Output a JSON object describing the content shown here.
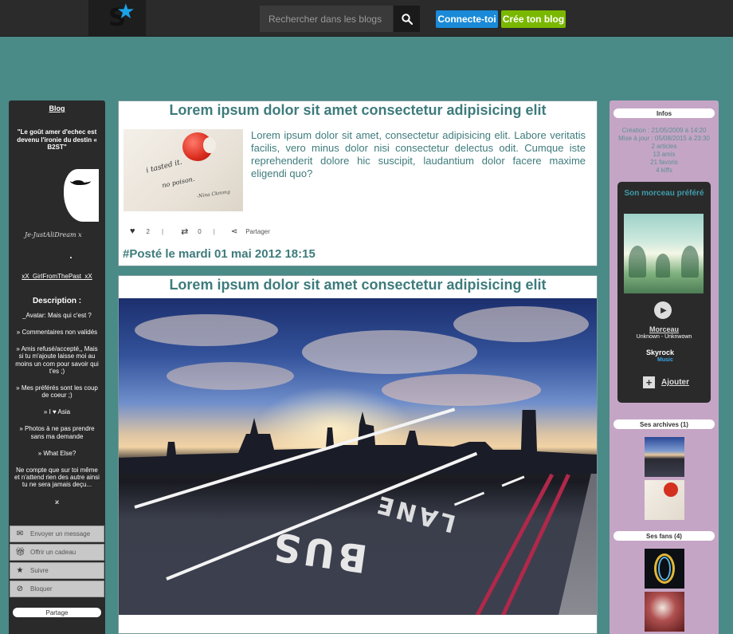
{
  "topbar": {
    "search_placeholder": "Rechercher dans les blogs",
    "connect_label": "Connecte-toi",
    "create_label": "Crée ton blog",
    "colors": {
      "connect": "#1a8ad8",
      "create": "#7ab800"
    }
  },
  "left": {
    "blog_link": "Blog",
    "quote": "\"Le goût amer d'echec est devenu l'ironie du destin « B2ST\"",
    "signature": "Je-JustAliDream x",
    "username": "xX_GirlFromThePast_xX",
    "description_title": "Description :",
    "description_lines": [
      "_Avatar: Mais qui c'est ?",
      "» Commentaires non validés",
      "» Amis refusé/accepté,, Mais si tu m'ajoute laisse moi au moins un com pour savoir qui t'es ;)",
      "» Mes préférés sont les coup de coeur ;)",
      "» I ♥ Asia",
      "» Photos à ne pas prendre sans ma demande",
      "» What Else?",
      "Ne compte que sur toi même et n'attend rien des autre ainsi tu ne sera jamais deçu...",
      "ϰ"
    ],
    "menu": [
      {
        "label": "Envoyer un message",
        "icon": "envelope-icon"
      },
      {
        "label": "Offrir un cadeau",
        "icon": "gift-icon"
      },
      {
        "label": "Suivre",
        "icon": "star-icon"
      },
      {
        "label": "Bloquer",
        "icon": "block-icon"
      }
    ],
    "partage_label": "Partage"
  },
  "posts": [
    {
      "title": "Lorem ipsum dolor sit amet consectetur adipisicing elit",
      "thumbnail_text": [
        "i tasted it.",
        "no poison.",
        "-Nina Ckmmg"
      ],
      "body": "Lorem ipsum dolor sit amet, consectetur adipisicing elit. Labore veritatis facilis, vero minus dolor nisi consectetur delectus odit. Cumque iste reprehenderit dolore hic suscipit, laudantium dolor facere maxime eligendi quo?",
      "likes": "2",
      "reposts": "0",
      "separator": "|",
      "share_label": "Partager",
      "posted": "#Posté le mardi 01 mai 2012 18:15"
    },
    {
      "title": "Lorem ipsum dolor sit amet consectetur adipisicing elit",
      "image_text": [
        "BUS",
        "LANE"
      ]
    }
  ],
  "right": {
    "infos_label": "Infos",
    "infos_lines": [
      "Création : 21/05/2009 à 14:20",
      "Mise à jour : 05/08/2015 à 23:30",
      "2 articles",
      "13 amis",
      "21 favoris",
      "4 kiffs"
    ],
    "player": {
      "title": "Son morceau préféré",
      "morceau_label": "Morceau",
      "artist": "Unknown - Unknwown",
      "brand": "Skyrock",
      "brand_sub": "Music",
      "add_label": "Ajouter"
    },
    "archives_label": "Ses archives (1)",
    "fans_label": "Ses fans (4)"
  },
  "colors": {
    "background": "#4a8a87",
    "title_text": "#3e7b7c",
    "left_sidebar": "#2a2a2a",
    "right_sidebar": "#c5a5c5"
  }
}
